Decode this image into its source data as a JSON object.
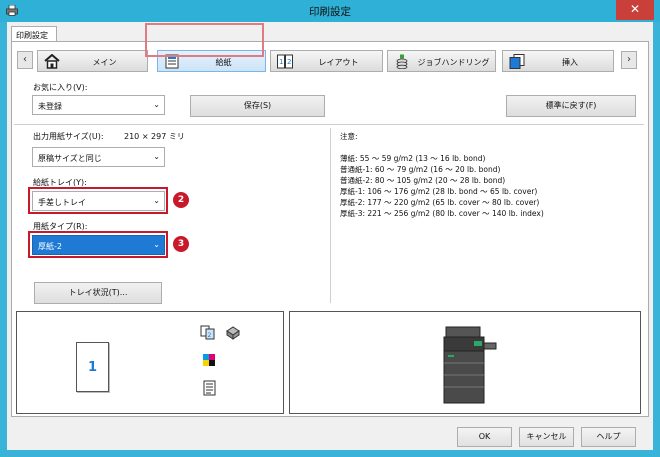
{
  "window": {
    "title": "印刷設定",
    "close_glyph": "✕"
  },
  "tabs": [
    {
      "label": "印刷設定"
    }
  ],
  "nav": {
    "prev_glyph": "‹",
    "next_glyph": "›"
  },
  "function_buttons": [
    {
      "label": "メイン",
      "icon": "home-icon"
    },
    {
      "label": "給紙",
      "icon": "paper-tray-icon",
      "selected": true
    },
    {
      "label": "レイアウト",
      "icon": "layout-icon"
    },
    {
      "label": "ジョブハンドリング",
      "icon": "job-handling-icon"
    },
    {
      "label": "挿入",
      "icon": "insert-icon"
    }
  ],
  "favorites": {
    "label": "お気に入り(V):",
    "value": "未登録",
    "save_label": "保存(S)",
    "restore_label": "標準に戻す(F)"
  },
  "output_paper": {
    "label": "出力用紙サイズ(U):",
    "size_text": "210 × 297 ミリ",
    "value": "原稿サイズと同じ"
  },
  "paper_tray": {
    "label": "給紙トレイ(Y):",
    "value": "手差しトレイ",
    "badge": "2"
  },
  "paper_type": {
    "label": "用紙タイプ(R):",
    "value": "厚紙-2",
    "badge": "3"
  },
  "tray_status_label": "トレイ状況(T)...",
  "notes": {
    "heading": "注意:",
    "lines": [
      "薄紙: 55 〜 59 g/m2 (13 〜 16 lb. bond)",
      "普通紙-1: 60 〜 79 g/m2 (16 〜 20 lb. bond)",
      "普通紙-2: 80 〜 105 g/m2 (20 〜 28 lb. bond)",
      "厚紙-1: 106 〜 176 g/m2 (28 lb. bond 〜 65 lb. cover)",
      "厚紙-2: 177 〜 220 g/m2 (65 lb. cover 〜 80 lb. cover)",
      "厚紙-3: 221 〜 256 g/m2 (80 lb. cover 〜 140 lb. index)"
    ]
  },
  "preview": {
    "page_number": "1"
  },
  "dialog_buttons": {
    "ok": "OK",
    "cancel": "キャンセル",
    "help": "ヘルプ"
  },
  "colors": {
    "titlebar": "#2fb0d6",
    "highlight": "#1e7ad4",
    "annotation_red": "#c8182a",
    "selected_tab_border": "#e07b83"
  }
}
